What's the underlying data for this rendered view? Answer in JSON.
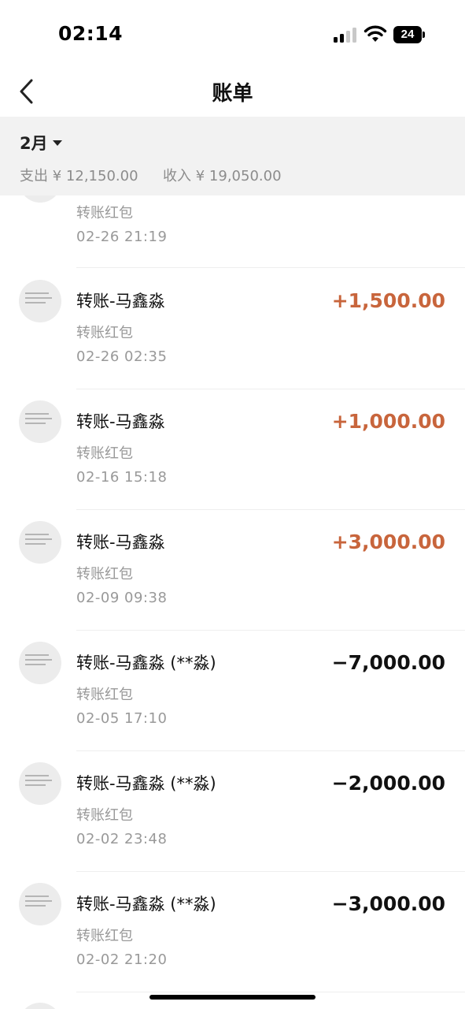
{
  "status_bar": {
    "time": "02:14",
    "battery": "24"
  },
  "nav": {
    "title": "账单"
  },
  "summary": {
    "month": "2月",
    "expense_label": "支出",
    "expense": "¥ 12,150.00",
    "income_label": "收入",
    "income": "¥ 19,050.00"
  },
  "transactions": [
    {
      "title": "",
      "subtitle": "转账红包",
      "time": "02-26  21:19",
      "amount": ""
    },
    {
      "title": "转账-马鑫淼",
      "subtitle": "转账红包",
      "time": "02-26  02:35",
      "amount": "+1,500.00",
      "type": "income"
    },
    {
      "title": "转账-马鑫淼",
      "subtitle": "转账红包",
      "time": "02-16  15:18",
      "amount": "+1,000.00",
      "type": "income"
    },
    {
      "title": "转账-马鑫淼",
      "subtitle": "转账红包",
      "time": "02-09  09:38",
      "amount": "+3,000.00",
      "type": "income"
    },
    {
      "title": "转账-马鑫淼 (**淼)",
      "subtitle": "转账红包",
      "time": "02-05  17:10",
      "amount": "−7,000.00",
      "type": "expense"
    },
    {
      "title": "转账-马鑫淼 (**淼)",
      "subtitle": "转账红包",
      "time": "02-02  23:48",
      "amount": "−2,000.00",
      "type": "expense"
    },
    {
      "title": "转账-马鑫淼 (**淼)",
      "subtitle": "转账红包",
      "time": "02-02  21:20",
      "amount": "−3,000.00",
      "type": "expense"
    }
  ],
  "colors": {
    "income": "#c8653c",
    "expense": "#111111",
    "summary_bg": "#f2f2f2"
  }
}
